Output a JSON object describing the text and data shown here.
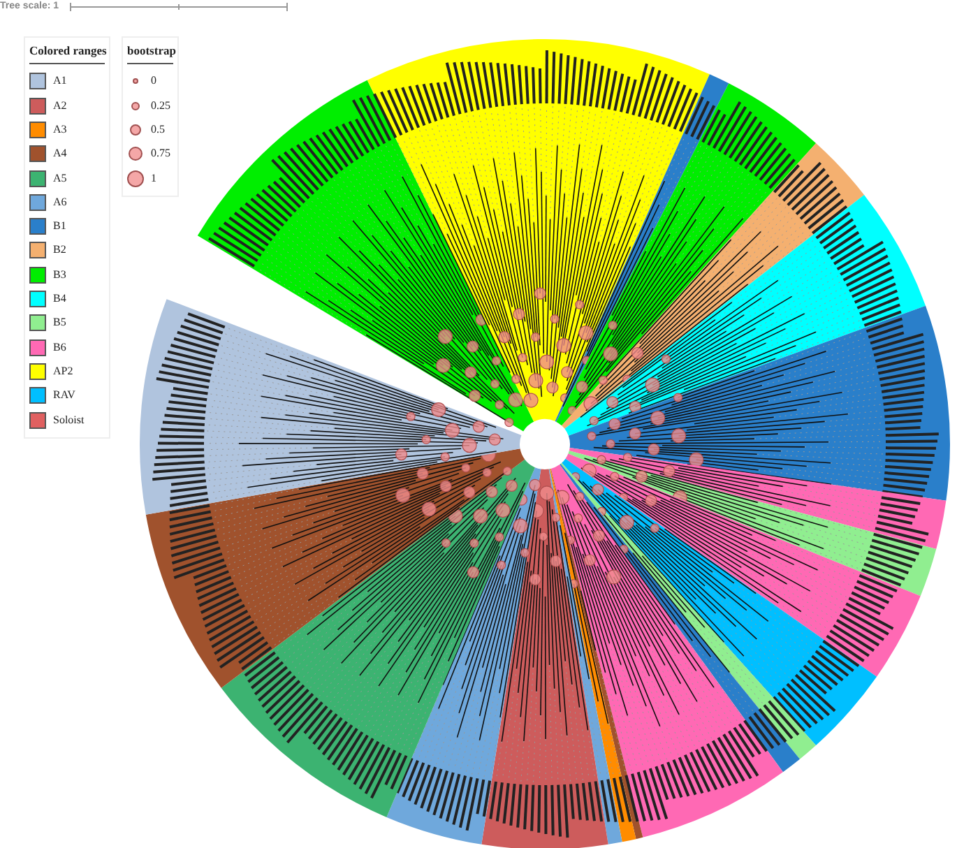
{
  "tree_scale": {
    "label": "Tree scale: 1"
  },
  "colored_ranges": {
    "title": "Colored ranges",
    "items": [
      {
        "label": "A1",
        "color": "#b0c4de"
      },
      {
        "label": "A2",
        "color": "#cd5c5c"
      },
      {
        "label": "A3",
        "color": "#ff8c00"
      },
      {
        "label": "A4",
        "color": "#a0522d"
      },
      {
        "label": "A5",
        "color": "#3cb371"
      },
      {
        "label": "A6",
        "color": "#6fa8dc"
      },
      {
        "label": "B1",
        "color": "#2a7fca"
      },
      {
        "label": "B2",
        "color": "#f4b070"
      },
      {
        "label": "B3",
        "color": "#00ee00"
      },
      {
        "label": "B4",
        "color": "#00ffff"
      },
      {
        "label": "B5",
        "color": "#90ee90"
      },
      {
        "label": "B6",
        "color": "#ff69b4"
      },
      {
        "label": "AP2",
        "color": "#ffff00"
      },
      {
        "label": "RAV",
        "color": "#00bfff"
      },
      {
        "label": "Soloist",
        "color": "#e06060"
      }
    ]
  },
  "bootstrap": {
    "title": "bootstrap",
    "items": [
      {
        "label": "0"
      },
      {
        "label": "0.25"
      },
      {
        "label": "0.5"
      },
      {
        "label": "0.75"
      },
      {
        "label": "1"
      }
    ]
  }
}
